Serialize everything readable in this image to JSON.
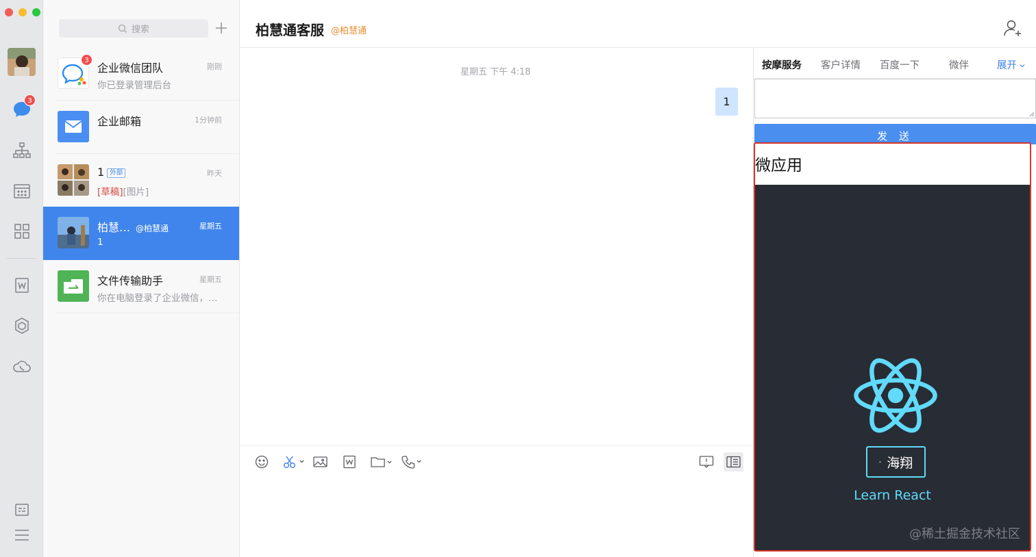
{
  "colors": {
    "accent": "#4085ec",
    "badge": "#f04f4f",
    "react": "#61dafb",
    "highlight_border": "#d8352a",
    "org_tag": "#e58c2f"
  },
  "rail": {
    "chat_badge": "3",
    "icons": [
      "profile-avatar",
      "message-icon",
      "org-chart-icon",
      "calendar-icon",
      "apps-grid-icon",
      "document-icon",
      "workbench-icon",
      "cloud-disk-icon",
      "settings-icon",
      "menu-icon"
    ]
  },
  "search": {
    "placeholder": "搜索"
  },
  "conversations": [
    {
      "name": "企业微信团队",
      "time": "刚刚",
      "preview": "你已登录管理后台",
      "badge": "3"
    },
    {
      "name": "企业邮箱",
      "time": "1分钟前",
      "preview": ""
    },
    {
      "name": "1",
      "tag": "外部",
      "time": "昨天",
      "draft_label": "[草稿]",
      "preview": "[图片]"
    },
    {
      "name": "柏慧…",
      "org": "@柏慧通",
      "time": "星期五",
      "preview": "1"
    },
    {
      "name": "文件传输助手",
      "time": "星期五",
      "preview": "你在电脑登录了企业微信，…"
    }
  ],
  "chat": {
    "title": "柏慧通客服",
    "org": "@柏慧通",
    "timestamp": "星期五 下午 4:18",
    "message": "1"
  },
  "side_panel": {
    "tabs": [
      "按摩服务",
      "客户详情",
      "百度一下",
      "微伴"
    ],
    "expand_label": "展开",
    "send_label": "发 送",
    "micro_app_title": "微应用",
    "name_button": "海翔",
    "name_dash": "-",
    "learn_link": "Learn React",
    "watermark": "@稀土掘金技术社区"
  }
}
